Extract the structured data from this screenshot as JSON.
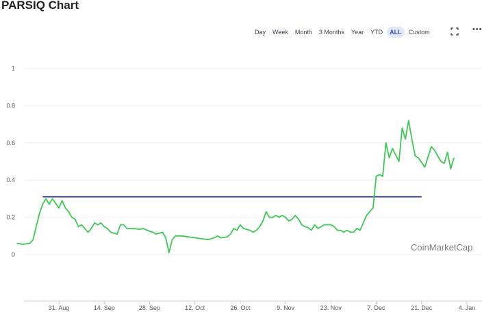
{
  "title": "PARSIQ Chart",
  "range_buttons": [
    "Day",
    "Week",
    "Month",
    "3 Months",
    "Year",
    "YTD",
    "ALL",
    "Custom"
  ],
  "active_range": "ALL",
  "watermark": "CoinMarketCap",
  "colors": {
    "line": "#3cc852",
    "reference": "#1b2aa6",
    "grid": "#eeeeee",
    "active": "#2b55cc"
  },
  "icons": [
    "fullscreen-icon",
    "more-icon"
  ],
  "chart_data": {
    "type": "line",
    "title": "PARSIQ Chart",
    "xlabel": "",
    "ylabel": "",
    "ylim": [
      -0.25,
      1.0
    ],
    "y_ticks": [
      "0",
      "0.2",
      "0.4",
      "0.6",
      "0.8",
      "1"
    ],
    "x_ticks": [
      "31. Aug",
      "14. Sep",
      "28. Sep",
      "12. Oct",
      "26. Oct",
      "9. Nov",
      "23. Nov",
      "7. Dec",
      "21. Dec",
      "4. Jan"
    ],
    "x_tick_days": [
      14,
      28,
      42,
      56,
      70,
      84,
      98,
      112,
      126,
      140
    ],
    "grid": true,
    "series": [
      {
        "points": [
          [
            -13,
            0.06
          ],
          [
            -11,
            0.055
          ],
          [
            -9,
            0.06
          ],
          [
            -8,
            0.08
          ],
          [
            -6,
            0.22
          ],
          [
            -5,
            0.27
          ],
          [
            -4,
            0.3
          ],
          [
            -3,
            0.27
          ],
          [
            -2,
            0.3
          ],
          [
            0,
            0.25
          ],
          [
            1,
            0.29
          ],
          [
            2,
            0.25
          ],
          [
            3,
            0.23
          ],
          [
            4,
            0.2
          ],
          [
            5,
            0.19
          ],
          [
            6,
            0.15
          ],
          [
            7,
            0.16
          ],
          [
            9,
            0.12
          ],
          [
            10,
            0.14
          ],
          [
            11,
            0.17
          ],
          [
            12,
            0.16
          ],
          [
            13,
            0.17
          ],
          [
            14,
            0.15
          ],
          [
            15,
            0.14
          ],
          [
            16,
            0.12
          ],
          [
            18,
            0.11
          ],
          [
            19,
            0.16
          ],
          [
            20,
            0.16
          ],
          [
            21,
            0.14
          ],
          [
            23,
            0.14
          ],
          [
            25,
            0.135
          ],
          [
            26,
            0.14
          ],
          [
            28,
            0.125
          ],
          [
            29,
            0.12
          ],
          [
            30,
            0.11
          ],
          [
            32,
            0.12
          ],
          [
            33,
            0.09
          ],
          [
            34,
            0.01
          ],
          [
            35,
            0.08
          ],
          [
            36,
            0.1
          ],
          [
            38,
            0.1
          ],
          [
            40,
            0.095
          ],
          [
            42,
            0.09
          ],
          [
            44,
            0.085
          ],
          [
            46,
            0.08
          ],
          [
            48,
            0.09
          ],
          [
            49,
            0.1
          ],
          [
            50,
            0.09
          ],
          [
            52,
            0.095
          ],
          [
            53,
            0.11
          ],
          [
            54,
            0.14
          ],
          [
            55,
            0.13
          ],
          [
            56,
            0.16
          ],
          [
            57,
            0.14
          ],
          [
            59,
            0.13
          ],
          [
            60,
            0.12
          ],
          [
            61,
            0.13
          ],
          [
            62,
            0.15
          ],
          [
            63,
            0.18
          ],
          [
            64,
            0.23
          ],
          [
            65,
            0.2
          ],
          [
            66,
            0.2
          ],
          [
            67,
            0.21
          ],
          [
            68,
            0.2
          ],
          [
            69,
            0.21
          ],
          [
            70,
            0.2
          ],
          [
            71,
            0.18
          ],
          [
            72,
            0.19
          ],
          [
            73,
            0.21
          ],
          [
            74,
            0.19
          ],
          [
            75,
            0.16
          ],
          [
            76,
            0.15
          ],
          [
            77,
            0.145
          ],
          [
            78,
            0.13
          ],
          [
            79,
            0.16
          ],
          [
            80,
            0.14
          ],
          [
            81,
            0.15
          ],
          [
            82,
            0.16
          ],
          [
            84,
            0.16
          ],
          [
            85,
            0.15
          ],
          [
            86,
            0.13
          ],
          [
            87,
            0.13
          ],
          [
            88,
            0.12
          ],
          [
            89,
            0.13
          ],
          [
            90,
            0.12
          ],
          [
            91,
            0.12
          ],
          [
            92,
            0.14
          ],
          [
            93,
            0.13
          ],
          [
            94,
            0.17
          ],
          [
            95,
            0.21
          ],
          [
            96,
            0.23
          ],
          [
            97,
            0.25
          ],
          [
            98,
            0.42
          ],
          [
            99,
            0.43
          ],
          [
            100,
            0.42
          ],
          [
            101,
            0.6
          ],
          [
            102,
            0.52
          ],
          [
            103,
            0.57
          ],
          [
            105,
            0.5
          ],
          [
            106,
            0.68
          ],
          [
            107,
            0.62
          ],
          [
            108,
            0.72
          ],
          [
            109,
            0.62
          ],
          [
            110,
            0.53
          ],
          [
            111,
            0.52
          ],
          [
            113,
            0.47
          ],
          [
            115,
            0.58
          ],
          [
            116,
            0.56
          ],
          [
            118,
            0.5
          ],
          [
            119,
            0.49
          ],
          [
            120,
            0.55
          ],
          [
            121,
            0.46
          ],
          [
            122,
            0.52
          ]
        ]
      }
    ],
    "reference_line": {
      "y": 0.31,
      "x_start": -5,
      "x_end": 112
    }
  }
}
